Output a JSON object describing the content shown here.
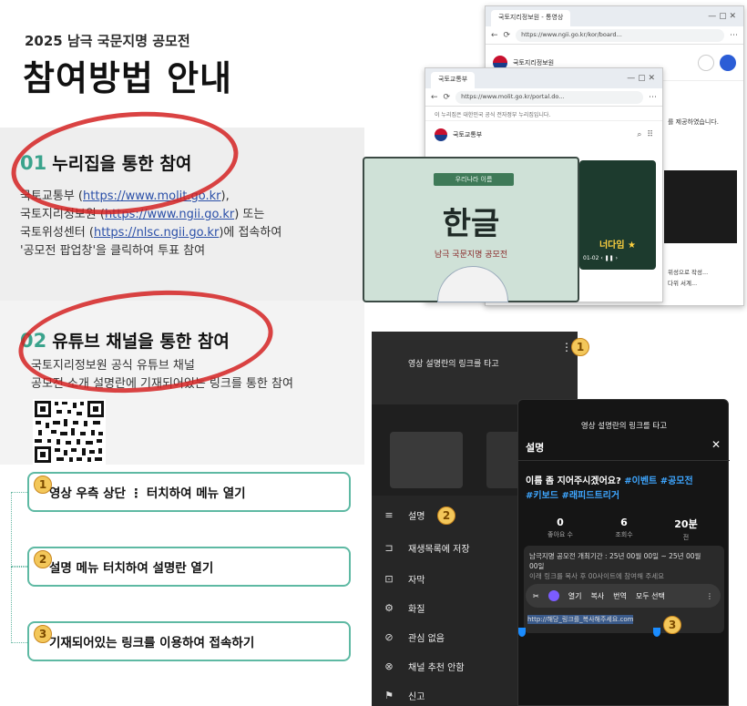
{
  "header": {
    "subtitle": "2025 남극 국문지명 공모전",
    "title": "참여방법 안내"
  },
  "section1": {
    "number": "01",
    "heading": "누리집을 통한 참여",
    "line1_a": "국토교통부 (",
    "line1_link": "https://www.molit.go.kr",
    "line1_b": "),",
    "line2_a": "국토지리정보원 (",
    "line2_link": "https://www.ngii.go.kr",
    "line2_b": ") 또는",
    "line3_a": "국토위성센터 (",
    "line3_link": "https://nlsc.ngii.go.kr",
    "line3_b": ")에 접속하여",
    "line4": "'공모전 팝업창'을 클릭하여 투표 참여"
  },
  "section2": {
    "number": "02",
    "heading": "유튜브 채널을 통한 참여",
    "line1": "국토지리정보원 공식 유튜브 채널",
    "line2": "공모전 소개 설명란에 기재되어있는 링크를 통한 참여"
  },
  "steps": [
    {
      "badge": "1",
      "text": "영상 우측 상단  ⋮  터치하여 메뉴 열기"
    },
    {
      "badge": "2",
      "text": "설명 메뉴 터치하여 설명란 열기"
    },
    {
      "badge": "3",
      "text": "기재되어있는 링크를 이용하여 접속하기"
    }
  ],
  "browser_back": {
    "tab_label": "국토지리정보원 - 통영상",
    "url": "https://www.ngii.go.kr/kor/board...",
    "org_name": "국토지리정보원",
    "side_text": "를 제공하였습니다.",
    "side_text2": "위성으로 작성...",
    "side_text3": "다위 서계..."
  },
  "browser_front": {
    "tab_label": "국토교통부",
    "url": "https://www.molit.go.kr/portal.do...",
    "notice": "이 누리집은 대한민국 공식 전자정부 누리집입니다.",
    "org_name": "국토교통부",
    "popup_top_label": "우리나라 이름",
    "popup_title": "한글",
    "popup_subtitle": "남극 국문지명 공모전",
    "thumb_text": "너다임 ★",
    "thumb_pager": "01-02  ‹ ❚❚ ›"
  },
  "youtube_menu": {
    "overlay_text": "영상 설명란의 링크를 타고",
    "badge1": "1",
    "items": [
      {
        "icon": "≡",
        "label": "설명",
        "badge": "2"
      },
      {
        "icon": "⊐",
        "label": "재생목록에 저장"
      },
      {
        "icon": "⊡",
        "label": "자막"
      },
      {
        "icon": "⚙",
        "label": "화질"
      },
      {
        "icon": "⊘",
        "label": "관심 없음"
      },
      {
        "icon": "⊗",
        "label": "채널 추천 안함"
      },
      {
        "icon": "⚑",
        "label": "신고"
      }
    ]
  },
  "youtube_desc": {
    "overlay_text": "영상 설명란의 링크를 타고",
    "panel_title": "설명",
    "video_title_plain": "이름 좀 지어주시겠어요? ",
    "video_title_tags1": "#이벤트 #공모전",
    "video_title_tags2": "#키보드 #래피드트리거",
    "stats": [
      {
        "value": "0",
        "label": "좋아요 수"
      },
      {
        "value": "6",
        "label": "조회수"
      },
      {
        "value": "20분",
        "label": "전"
      }
    ],
    "desc_line1": "남극지명 공모전 개최기간 : 25년 00월 00일 ~ 25년 00월",
    "desc_line2": "00일",
    "desc_line3": "이래 링크를 복사 후 00사이트에 참여해 주세요",
    "context_items": [
      "열기",
      "복사",
      "번역",
      "모두 선택"
    ],
    "link_text": "http://해당_링크를_복사해주세요.com",
    "badge3": "3"
  }
}
